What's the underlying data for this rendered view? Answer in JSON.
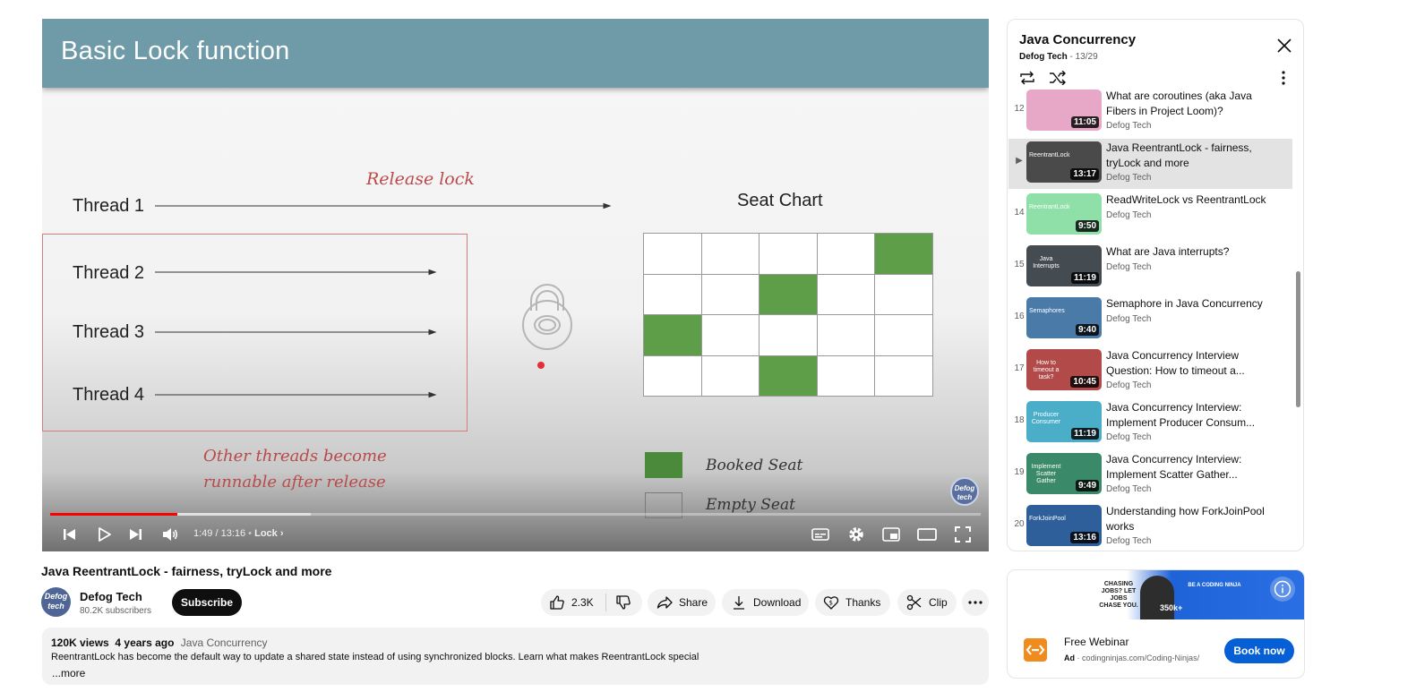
{
  "slide": {
    "title": "Basic Lock function",
    "threads": [
      "Thread 1",
      "Thread 2",
      "Thread 3",
      "Thread 4"
    ],
    "release_lock": "Release lock",
    "other_threads_line1": "Other threads become",
    "other_threads_line2": "runnable after release",
    "seat_chart_title": "Seat Chart",
    "booked_seats": [
      [
        0,
        4
      ],
      [
        1,
        2
      ],
      [
        2,
        0
      ],
      [
        3,
        2
      ]
    ],
    "legend_booked": "Booked Seat",
    "legend_empty": "Empty Seat",
    "watermark_line1": "Defog",
    "watermark_line2": "tech",
    "booked_color": "#5e9e48"
  },
  "player": {
    "time": "1:49 / 13:16",
    "chapter": "Lock",
    "progress_fraction": 0.137,
    "buffer_fraction": 0.28,
    "progress_color": "#ff0000",
    "icons": [
      "previous-icon",
      "play-icon",
      "next-icon",
      "volume-icon",
      "subtitles-icon",
      "settings-icon",
      "miniplayer-icon",
      "theater-icon",
      "fullscreen-icon"
    ]
  },
  "video": {
    "title": "Java ReentrantLock - fairness, tryLock and more",
    "channel": "Defog Tech",
    "subscribers": "80.2K subscribers",
    "avatar_line1": "Defog",
    "avatar_line2": "tech",
    "subscribe_label": "Subscribe",
    "likes": "2.3K",
    "share_label": "Share",
    "download_label": "Download",
    "thanks_label": "Thanks",
    "clip_label": "Clip"
  },
  "description": {
    "views": "120K views",
    "age": "4 years ago",
    "playlist": "Java Concurrency",
    "text": "ReentrantLock has become the default way to update a shared state instead of using synchronized blocks. Learn what makes ReentrantLock special",
    "more_label": "...more"
  },
  "playlist": {
    "title": "Java Concurrency",
    "channel": "Defog Tech",
    "position": " - 13/29",
    "items": [
      {
        "index": "12",
        "title": "What are coroutines (aka Java Fibers in Project Loom)?",
        "channel": "Defog Tech",
        "duration": "11:05",
        "thumb_text": "",
        "thumb_color": "#e7a8c8",
        "active": false
      },
      {
        "index": "▶",
        "title": "Java ReentrantLock - fairness, tryLock and more",
        "channel": "Defog Tech",
        "duration": "13:17",
        "thumb_text": "ReentrantLock",
        "thumb_color": "#4a4a4a",
        "active": true
      },
      {
        "index": "14",
        "title": "ReadWriteLock vs ReentrantLock",
        "channel": "Defog Tech",
        "duration": "9:50",
        "thumb_text": "ReentrantLock",
        "thumb_color": "#8fe0a8",
        "active": false
      },
      {
        "index": "15",
        "title": "What are Java interrupts?",
        "channel": "Defog Tech",
        "duration": "11:19",
        "thumb_text": "Java Interrupts",
        "thumb_color": "#444c52",
        "active": false
      },
      {
        "index": "16",
        "title": "Semaphore in Java Concurrency",
        "channel": "Defog Tech",
        "duration": "9:40",
        "thumb_text": "Semaphores",
        "thumb_color": "#4a7aa8",
        "active": false
      },
      {
        "index": "17",
        "title": "Java Concurrency Interview Question: How to timeout a...",
        "channel": "Defog Tech",
        "duration": "10:45",
        "thumb_text": "How to timeout a task?",
        "thumb_color": "#b24a4a",
        "active": false
      },
      {
        "index": "18",
        "title": "Java Concurrency Interview: Implement Producer Consum...",
        "channel": "Defog Tech",
        "duration": "11:19",
        "thumb_text": "Producer Consumer",
        "thumb_color": "#4aaec8",
        "active": false
      },
      {
        "index": "19",
        "title": "Java Concurrency Interview: Implement Scatter Gather...",
        "channel": "Defog Tech",
        "duration": "9:49",
        "thumb_text": "Implement Scatter Gather",
        "thumb_color": "#3a8a6a",
        "active": false
      },
      {
        "index": "20",
        "title": "Understanding how ForkJoinPool works",
        "channel": "Defog Tech",
        "duration": "13:16",
        "thumb_text": "ForkJoinPool",
        "thumb_color": "#2f5f9a",
        "active": false
      }
    ]
  },
  "ad": {
    "banner_text": "CHASING JOBS? LET JOBS CHASE YOU.",
    "banner_right": "BE A CODING NINJA",
    "banner_count": "350k+",
    "title": "Free Webinar",
    "label": "Ad",
    "domain": "codingninjas.com/Coding-Ninjas/",
    "cta": "Book now",
    "brand_color": "#065fd4"
  }
}
